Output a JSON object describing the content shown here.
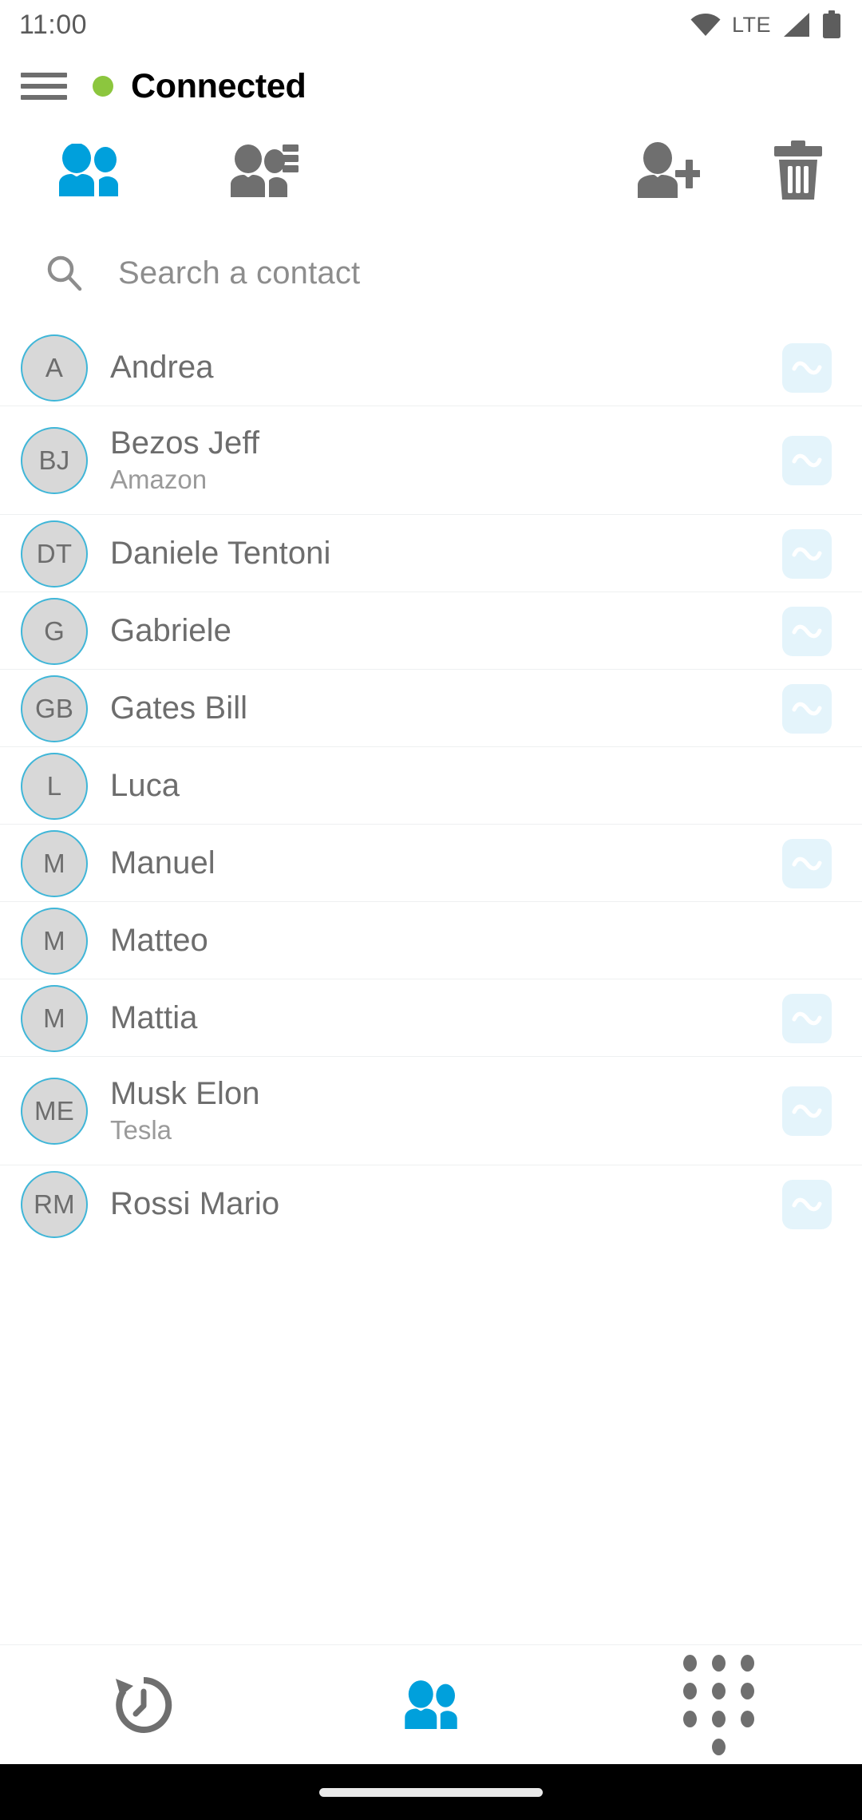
{
  "status_bar": {
    "time": "11:00",
    "network_label": "LTE",
    "icons": [
      "wifi-icon",
      "signal-icon",
      "battery-icon"
    ]
  },
  "header": {
    "menu_icon": "hamburger-menu-icon",
    "connection_status": "Connected",
    "status_color": "#8CC63E"
  },
  "toolbar": {
    "items": [
      {
        "name": "local-contacts",
        "icon": "two-users-icon",
        "active": true,
        "color": "#00A0DC"
      },
      {
        "name": "server-contacts",
        "icon": "users-server-list-icon",
        "active": false,
        "color": "#6f6f6f"
      },
      {
        "name": "add-contact",
        "icon": "user-plus-icon",
        "active": false,
        "color": "#6f6f6f"
      },
      {
        "name": "delete-contact",
        "icon": "trash-icon",
        "active": false,
        "color": "#6f6f6f"
      }
    ]
  },
  "search": {
    "icon": "search-icon",
    "placeholder": "Search a contact",
    "value": ""
  },
  "contacts": {
    "presence_icon": "wave-tilde-icon",
    "items": [
      {
        "initials": "A",
        "name": "Andrea",
        "subtitle": "",
        "presence": true
      },
      {
        "initials": "BJ",
        "name": "Bezos Jeff",
        "subtitle": "Amazon",
        "presence": true
      },
      {
        "initials": "DT",
        "name": "Daniele Tentoni",
        "subtitle": "",
        "presence": true
      },
      {
        "initials": "G",
        "name": "Gabriele",
        "subtitle": "",
        "presence": true
      },
      {
        "initials": "GB",
        "name": "Gates Bill",
        "subtitle": "",
        "presence": true
      },
      {
        "initials": "L",
        "name": "Luca",
        "subtitle": "",
        "presence": false
      },
      {
        "initials": "M",
        "name": "Manuel",
        "subtitle": "",
        "presence": true
      },
      {
        "initials": "M",
        "name": "Matteo",
        "subtitle": "",
        "presence": false
      },
      {
        "initials": "M",
        "name": "Mattia",
        "subtitle": "",
        "presence": true
      },
      {
        "initials": "ME",
        "name": "Musk Elon",
        "subtitle": "Tesla",
        "presence": true
      },
      {
        "initials": "RM",
        "name": "Rossi Mario",
        "subtitle": "",
        "presence": true
      }
    ]
  },
  "bottom_nav": {
    "items": [
      {
        "name": "history",
        "icon": "history-clock-icon",
        "active": false,
        "color": "#6f6f6f"
      },
      {
        "name": "contacts",
        "icon": "two-users-icon",
        "active": true,
        "color": "#00A0DC"
      },
      {
        "name": "dialpad",
        "icon": "dialpad-icon",
        "active": false,
        "color": "#6f6f6f"
      }
    ]
  },
  "gesture_bar": {
    "handle": "home-indicator"
  }
}
